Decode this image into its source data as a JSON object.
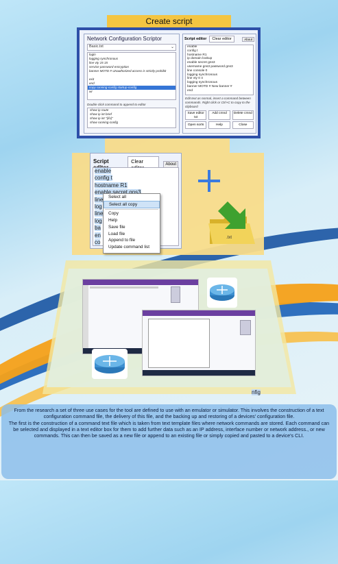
{
  "title": "Create script",
  "top_screenshot": {
    "window_title": "Network Configuration Scriptor",
    "combo_value": "Basic.txt",
    "command_list": [
      "login",
      "logging synchronous",
      "line vty 15 15",
      "service password encryption",
      "banner MOTD # Unauthorized access is strictly prohibit",
      "",
      "exit",
      "end",
      "copy running-config startup-config",
      "wr"
    ],
    "selected_index": 8,
    "hint": "Double click command to append to editor",
    "show_commands": [
      "show ip route",
      "show ip int brief",
      "show ip int \"{ifx}\"",
      "show running-config"
    ],
    "editor": {
      "label": "Script editor",
      "clear_label": "Clear editor",
      "about_label": "About",
      "lines": [
        "enable",
        "config t",
        "hostname R1",
        "ip domain lookup",
        "enable secret gns3",
        "username gns3 password gns3",
        "line console 0",
        "logging synchronous",
        "line vty 0 4",
        "logging synchronous",
        "banner MOTD # New banner #",
        "end"
      ],
      "note": "Edit text as normal, insert a command between commands. Right click or Ctrl+C to copy to the clipboard",
      "buttons": [
        "Save editor txt",
        "Add cmnd",
        "Delete cmnd"
      ],
      "buttons2": [
        "Open sorts",
        "Help",
        "Close"
      ]
    }
  },
  "middle_editor": {
    "label": "Script editor",
    "clear_label": "Clear editor",
    "about_label": "About",
    "lines": [
      "enable",
      "config t",
      "hostname R1",
      "enable secret gns3",
      "line",
      "log",
      "line",
      "log",
      "ba",
      "en",
      "co"
    ],
    "partial_right": "nfig",
    "context_menu": [
      "Select all",
      "Select all copy",
      "Copy",
      "Help",
      "Save file",
      "Load file",
      "Append to file",
      "Update command list"
    ],
    "highlighted_index": 1
  },
  "file_label": ".txt",
  "description": [
    "From the research a set of three use cases for the tool are defined to use with an emulator or simulator. This involves the construction of a text configuration command file, the delivery of this file, and the backing up and restoring of a devices' configuration file.",
    "The first is the construction of a command text file which is taken from text template files where network commands are stored. Each command can be selected and displayed in a text editor box for them to add further data such as an IP address, interface number or network address., or new commands. This can then be saved as a new file or append to an existing file or simply copied and pasted to a device's CLI."
  ],
  "colors": {
    "title_bg": "#f4c542",
    "funnel": "#f9dc8a",
    "funnel_bottom": "#dfeedd",
    "selection": "#3575d6",
    "plus": "#3a7be0"
  },
  "icons": [
    "plus-icon",
    "folder-icon",
    "arrow-icon",
    "router-icon"
  ]
}
